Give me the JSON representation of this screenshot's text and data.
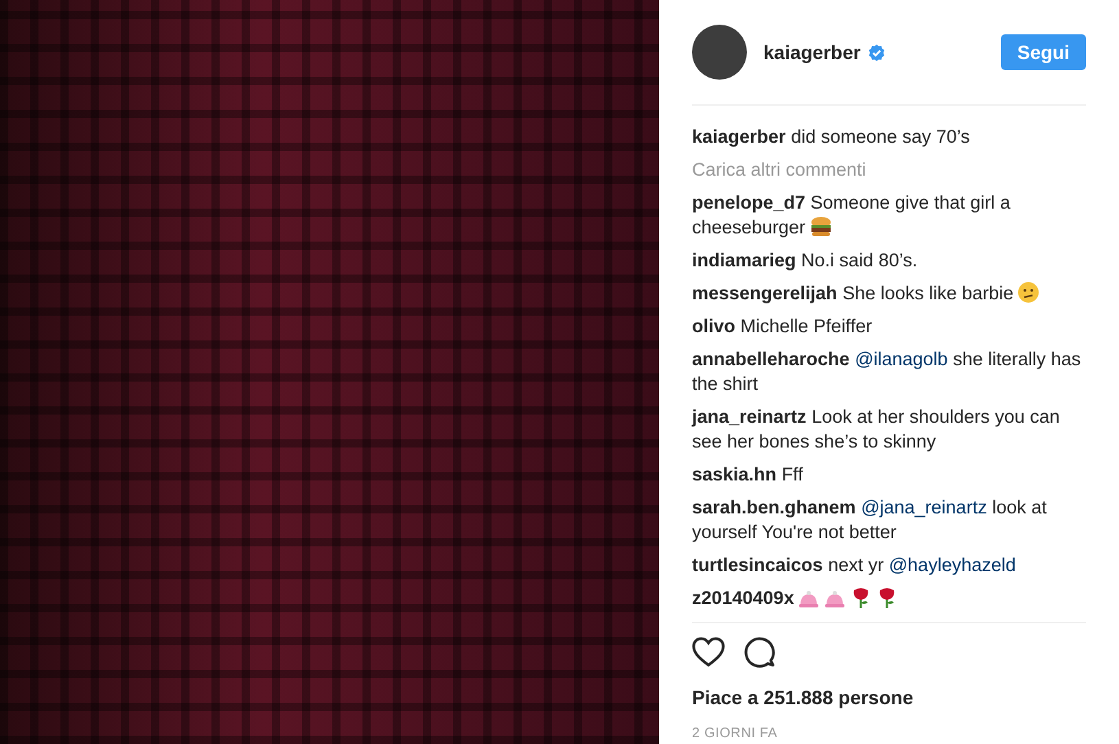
{
  "header": {
    "username": "kaiagerber",
    "verified": true,
    "follow_button": "Segui"
  },
  "caption": {
    "user": "kaiagerber",
    "parts": [
      {
        "kind": "text",
        "text": "did someone say 70’s"
      }
    ]
  },
  "load_more": "Carica altri commenti",
  "comments": [
    {
      "user": "penelope_d7",
      "parts": [
        {
          "kind": "text",
          "text": "Someone give that girl a cheeseburger"
        }
      ],
      "emojis": [
        {
          "kind": "burger"
        }
      ]
    },
    {
      "user": "indiamarieg",
      "parts": [
        {
          "kind": "text",
          "text": "No.i said 80’s."
        }
      ]
    },
    {
      "user": "messengerelijah",
      "parts": [
        {
          "kind": "text",
          "text": "She looks like barbie"
        }
      ],
      "emojis": [
        {
          "kind": "confused"
        }
      ]
    },
    {
      "user": "olivo",
      "parts": [
        {
          "kind": "text",
          "text": "Michelle Pfeiffer"
        }
      ]
    },
    {
      "user": "annabelleharoche",
      "parts": [
        {
          "kind": "mention",
          "text": "@ilanagolb"
        },
        {
          "kind": "text",
          "text": "she literally has the shirt"
        }
      ]
    },
    {
      "user": "jana_reinartz",
      "parts": [
        {
          "kind": "text",
          "text": "Look at her shoulders you can see her bones she’s to skinny"
        }
      ]
    },
    {
      "user": "saskia.hn",
      "parts": [
        {
          "kind": "text",
          "text": "Fff"
        }
      ]
    },
    {
      "user": "sarah.ben.ghanem",
      "parts": [
        {
          "kind": "mention",
          "text": "@jana_reinartz"
        },
        {
          "kind": "text",
          "text": "look at yourself You're not better"
        }
      ]
    },
    {
      "user": "turtlesincaicos",
      "parts": [
        {
          "kind": "text",
          "text": "next yr"
        },
        {
          "kind": "mention",
          "text": "@hayleyhazeld"
        }
      ]
    },
    {
      "user": "z20140409x",
      "emojis": [
        {
          "kind": "cake"
        },
        {
          "kind": "cake"
        },
        {
          "kind": "rose"
        },
        {
          "kind": "rose"
        }
      ]
    }
  ],
  "actions": {
    "liked": false
  },
  "likes": "Piace a 251.888 persone",
  "date": "2 GIORNI FA"
}
